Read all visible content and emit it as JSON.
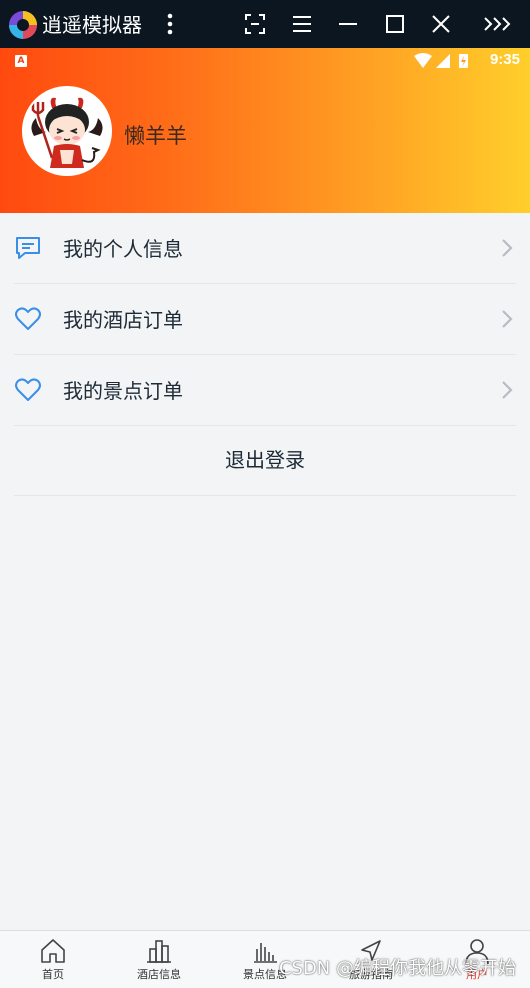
{
  "emulator": {
    "title": "逍遥模拟器",
    "buttons": [
      "more-vertical-icon",
      "screenshot-icon",
      "menu-icon",
      "minimize-icon",
      "maximize-icon",
      "close-icon",
      "expand-sidebar-icon"
    ]
  },
  "statusbar": {
    "badge": "A",
    "time": "9:35"
  },
  "profile": {
    "username": "懒羊羊",
    "avatar": "devil-cartoon-avatar"
  },
  "menu": {
    "items": [
      {
        "label": "我的个人信息",
        "icon": "message-icon"
      },
      {
        "label": "我的酒店订单",
        "icon": "heart-icon"
      },
      {
        "label": "我的景点订单",
        "icon": "heart-icon"
      }
    ],
    "logout_label": "退出登录"
  },
  "tabbar": {
    "tabs": [
      {
        "label": "首页",
        "icon": "home-icon"
      },
      {
        "label": "酒店信息",
        "icon": "chart-icon"
      },
      {
        "label": "景点信息",
        "icon": "bars-icon"
      },
      {
        "label": "旅游指南",
        "icon": "navigation-icon"
      },
      {
        "label": "用户",
        "icon": "user-icon",
        "active": true
      }
    ]
  },
  "watermark": "CSDN @编程你我他从零开始",
  "colors": {
    "header_start": "#ff4a0f",
    "header_end": "#ffcf2b",
    "icon_blue": "#3b8ee8",
    "tab_active": "#e8372a"
  }
}
